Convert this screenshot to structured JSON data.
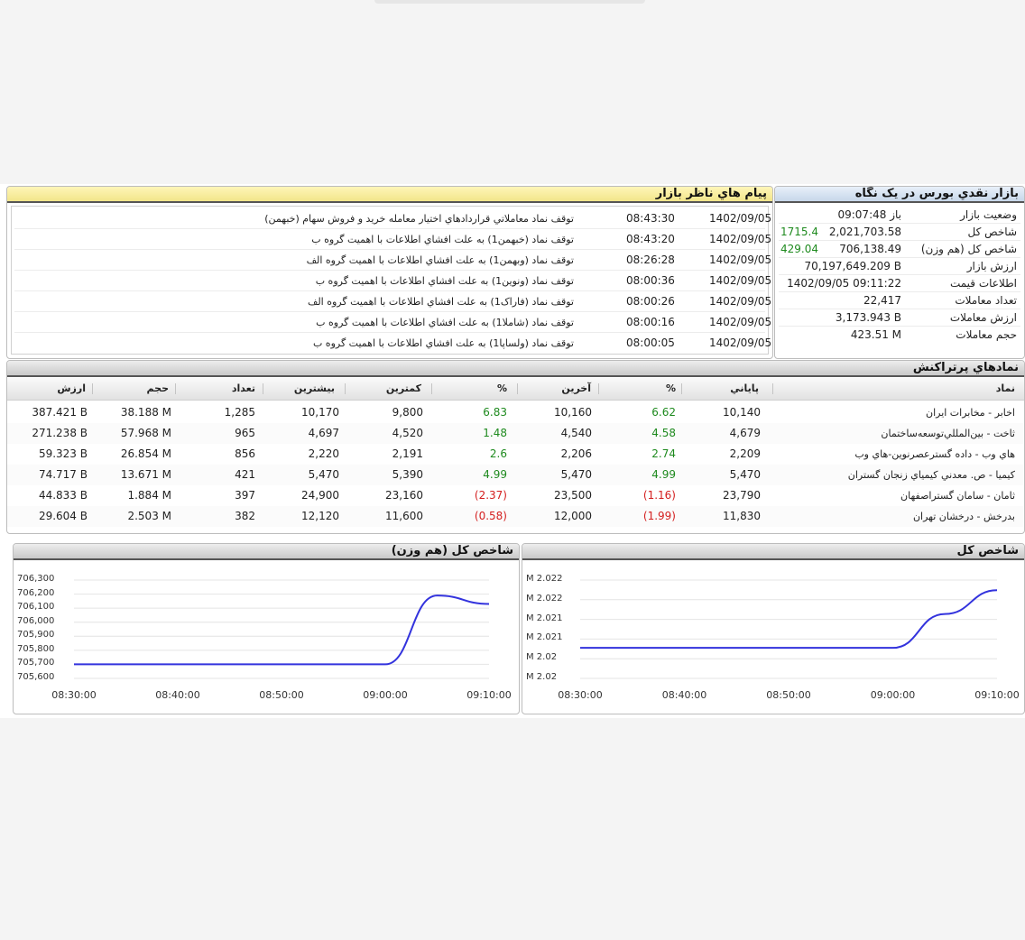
{
  "messages_panel": {
    "title": "پيام هاي ناظر بازار",
    "rows": [
      {
        "date": "1402/09/05",
        "time": "08:43:30",
        "text": "توقف نماد معاملاتي قراردادهاي اختيار معامله خريد و فروش سهام (خبهمن)"
      },
      {
        "date": "1402/09/05",
        "time": "08:43:20",
        "text": "توقف نماد (خبهمن1) به علت افشاي اطلاعات با اهميت گروه ب"
      },
      {
        "date": "1402/09/05",
        "time": "08:26:28",
        "text": "توقف نماد (وبهمن1) به علت افشاي اطلاعات با اهميت گروه الف"
      },
      {
        "date": "1402/09/05",
        "time": "08:00:36",
        "text": "توقف نماد (ونوين1) به علت افشاي اطلاعات با اهميت گروه ب"
      },
      {
        "date": "1402/09/05",
        "time": "08:00:26",
        "text": "توقف نماد (فاراک1) به علت افشاي اطلاعات با اهميت گروه الف"
      },
      {
        "date": "1402/09/05",
        "time": "08:00:16",
        "text": "توقف نماد (شاملا1) به علت افشاي اطلاعات با اهميت گروه ب"
      },
      {
        "date": "1402/09/05",
        "time": "08:00:05",
        "text": "توقف نماد (ولساپا1) به علت افشاي اطلاعات با اهميت گروه ب"
      }
    ]
  },
  "market_panel": {
    "title": "بازار نقدي بورس در يک نگاه",
    "rows": [
      {
        "label": "وضعيت بازار",
        "value": "باز 09:07:48",
        "change": ""
      },
      {
        "label": "شاخص کل",
        "value": "2,021,703.58",
        "change": "1715.4"
      },
      {
        "label": "شاخص کل (هم وزن)",
        "value": "706,138.49",
        "change": "429.04"
      },
      {
        "label": "ارزش بازار",
        "value": "70,197,649.209 B",
        "change": ""
      },
      {
        "label": "اطلاعات قيمت",
        "value": "1402/09/05 09:11:22",
        "change": ""
      },
      {
        "label": "تعداد معاملات",
        "value": "22,417",
        "change": ""
      },
      {
        "label": "ارزش معاملات",
        "value": "3,173.943 B",
        "change": ""
      },
      {
        "label": "حجم معاملات",
        "value": "423.51 M",
        "change": ""
      }
    ]
  },
  "symbols_panel": {
    "title": "نمادهاي پرتراکنش",
    "headers": {
      "symbol": "نماد",
      "close": "پاياني",
      "close_pct": "%",
      "last": "آخرين",
      "last_pct": "%",
      "low": "کمترين",
      "high": "بيشترين",
      "count": "تعداد",
      "volume": "حجم",
      "value": "ارزش"
    },
    "rows": [
      {
        "symbol": "اخابر - مخابرات ايران",
        "close": "10,140",
        "close_pct": "6.62",
        "close_dir": "up",
        "last": "10,160",
        "last_pct": "6.83",
        "last_dir": "up",
        "low": "9,800",
        "high": "10,170",
        "count": "1,285",
        "volume": "38.188 M",
        "value": "387.421 B"
      },
      {
        "symbol": "ثاخت - بين‌المللي‌توسعه‌ساختمان",
        "close": "4,679",
        "close_pct": "4.58",
        "close_dir": "up",
        "last": "4,540",
        "last_pct": "1.48",
        "last_dir": "up",
        "low": "4,520",
        "high": "4,697",
        "count": "965",
        "volume": "57.968 M",
        "value": "271.238 B"
      },
      {
        "symbol": "هاي وب - داده گسترعصرنوين-هاي وب",
        "close": "2,209",
        "close_pct": "2.74",
        "close_dir": "up",
        "last": "2,206",
        "last_pct": "2.6",
        "last_dir": "up",
        "low": "2,191",
        "high": "2,220",
        "count": "856",
        "volume": "26.854 M",
        "value": "59.323 B"
      },
      {
        "symbol": "کيميا - ص. معدني کيمياي زنجان گستران",
        "close": "5,470",
        "close_pct": "4.99",
        "close_dir": "up",
        "last": "5,470",
        "last_pct": "4.99",
        "last_dir": "up",
        "low": "5,390",
        "high": "5,470",
        "count": "421",
        "volume": "13.671 M",
        "value": "74.717 B"
      },
      {
        "symbol": "ثامان - سامان گستراصفهان",
        "close": "23,790",
        "close_pct": "(1.16)",
        "close_dir": "down",
        "last": "23,500",
        "last_pct": "(2.37)",
        "last_dir": "down",
        "low": "23,160",
        "high": "24,900",
        "count": "397",
        "volume": "1.884 M",
        "value": "44.833 B"
      },
      {
        "symbol": "بدرخش - درخشان تهران",
        "close": "11,830",
        "close_pct": "(1.99)",
        "close_dir": "down",
        "last": "12,000",
        "last_pct": "(0.58)",
        "last_dir": "down",
        "low": "11,600",
        "high": "12,120",
        "count": "382",
        "volume": "2.503 M",
        "value": "29.604 B"
      }
    ]
  },
  "colors": {
    "up": "#1e8a1e",
    "down": "#d42020",
    "line": "#3333dd"
  },
  "chart_data": [
    {
      "type": "line",
      "title": "شاخص کل (هم وزن)",
      "x": [
        "08:30:00",
        "08:40:00",
        "08:50:00",
        "09:00:00",
        "09:05:00",
        "09:10:00"
      ],
      "values": [
        705700,
        705700,
        705700,
        705700,
        706190,
        706130
      ],
      "yticks": [
        "706,300",
        "706,200",
        "706,100",
        "706,000",
        "705,900",
        "705,800",
        "705,700",
        "705,600"
      ],
      "ylim": [
        705600,
        706300
      ],
      "xticks": [
        "08:30:00",
        "08:40:00",
        "08:50:00",
        "09:00:00",
        "09:10:00"
      ]
    },
    {
      "type": "line",
      "title": "شاخص کل",
      "x": [
        "08:30:00",
        "08:40:00",
        "08:50:00",
        "09:00:00",
        "09:05:00",
        "09:10:00"
      ],
      "values": [
        2020000,
        2020000,
        2020000,
        2020000,
        2021000,
        2021700
      ],
      "yticks": [
        "M 2.022",
        "M 2.022",
        "M 2.021",
        "M 2.021",
        "M 2.02",
        "M 2.02"
      ],
      "ylim": [
        2019100,
        2022000
      ],
      "xticks": [
        "08:30:00",
        "08:40:00",
        "08:50:00",
        "09:00:00",
        "09:10:00"
      ]
    }
  ]
}
